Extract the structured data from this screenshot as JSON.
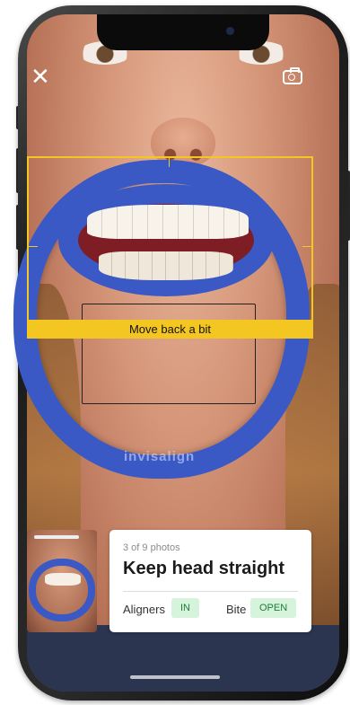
{
  "photo_counter": "3 of 9 photos",
  "instruction_banner": "Move back a bit",
  "card": {
    "title": "Keep head straight",
    "aligners_label": "Aligners",
    "aligners_value": "IN",
    "bite_label": "Bite",
    "bite_value": "OPEN"
  },
  "brand_watermark": "invisalign",
  "icons": {
    "close": "close-icon",
    "camera_switch": "camera-switch-icon"
  },
  "colors": {
    "guide_accent": "#f4c621",
    "status_pill_bg": "#d6f4dc",
    "status_pill_text": "#1f7a3a",
    "retractor_blue": "#3a59c5"
  }
}
